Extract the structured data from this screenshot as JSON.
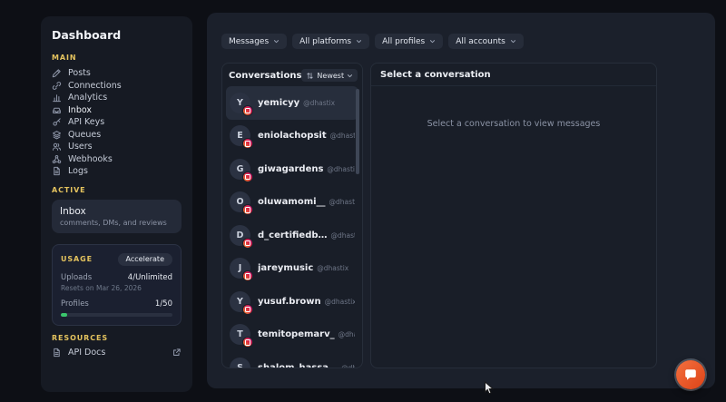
{
  "sidebar": {
    "title": "Dashboard",
    "sections": {
      "main_label": "MAIN",
      "active_label": "ACTIVE",
      "resources_label": "RESOURCES"
    },
    "menu": [
      {
        "label": "Posts",
        "icon": "pencil-icon"
      },
      {
        "label": "Connections",
        "icon": "link-icon"
      },
      {
        "label": "Analytics",
        "icon": "chart-icon"
      },
      {
        "label": "Inbox",
        "icon": "inbox-icon",
        "active": true
      },
      {
        "label": "API Keys",
        "icon": "key-icon"
      },
      {
        "label": "Queues",
        "icon": "layers-icon"
      },
      {
        "label": "Users",
        "icon": "users-icon"
      },
      {
        "label": "Webhooks",
        "icon": "webhook-icon"
      },
      {
        "label": "Logs",
        "icon": "file-icon"
      }
    ],
    "active_card": {
      "title": "Inbox",
      "subtitle": "comments, DMs, and reviews"
    },
    "usage_card": {
      "title": "USAGE",
      "button_label": "Accelerate",
      "uploads_label": "Uploads",
      "uploads_value": "4/Unlimited",
      "resets_text": "Resets on Mar 26, 2026",
      "profiles_label": "Profiles",
      "profiles_value": "1/50",
      "profiles_pct": 6
    },
    "resources": [
      {
        "label": "API Docs",
        "icon": "document-icon"
      }
    ]
  },
  "filters": [
    {
      "label": "Messages"
    },
    {
      "label": "All platforms"
    },
    {
      "label": "All profiles"
    },
    {
      "label": "All accounts"
    }
  ],
  "conversations": {
    "header": "Conversations",
    "sort_label": "Newest",
    "items": [
      {
        "initial": "Y",
        "name": "yemicyy",
        "handle": "@dhastix",
        "platform": "instagram",
        "selected": true
      },
      {
        "initial": "E",
        "name": "eniolachopsit",
        "handle": "@dhastix",
        "platform": "instagram"
      },
      {
        "initial": "G",
        "name": "giwagardens",
        "handle": "@dhastix",
        "platform": "instagram"
      },
      {
        "initial": "O",
        "name": "oluwamomi__",
        "handle": "@dhastix",
        "platform": "instagram"
      },
      {
        "initial": "D",
        "name": "d_certifiedb…",
        "handle": "@dhast…",
        "platform": "instagram"
      },
      {
        "initial": "J",
        "name": "jareymusic",
        "handle": "@dhastix",
        "platform": "instagram"
      },
      {
        "initial": "Y",
        "name": "yusuf.brown",
        "handle": "@dhastix",
        "platform": "instagram"
      },
      {
        "initial": "T",
        "name": "temitopemarv_",
        "handle": "@dhastix",
        "platform": "instagram"
      },
      {
        "initial": "S",
        "name": "shalom_hassa…",
        "handle": "@dhas…",
        "platform": "instagram"
      }
    ]
  },
  "detail": {
    "header": "Select a conversation",
    "empty_text": "Select a conversation to view messages"
  },
  "colors": {
    "accent_yellow": "#e4c35e",
    "instagram_pink": "#dc2743",
    "fab_orange": "#e8502a",
    "progress_green": "#3ac56c"
  }
}
